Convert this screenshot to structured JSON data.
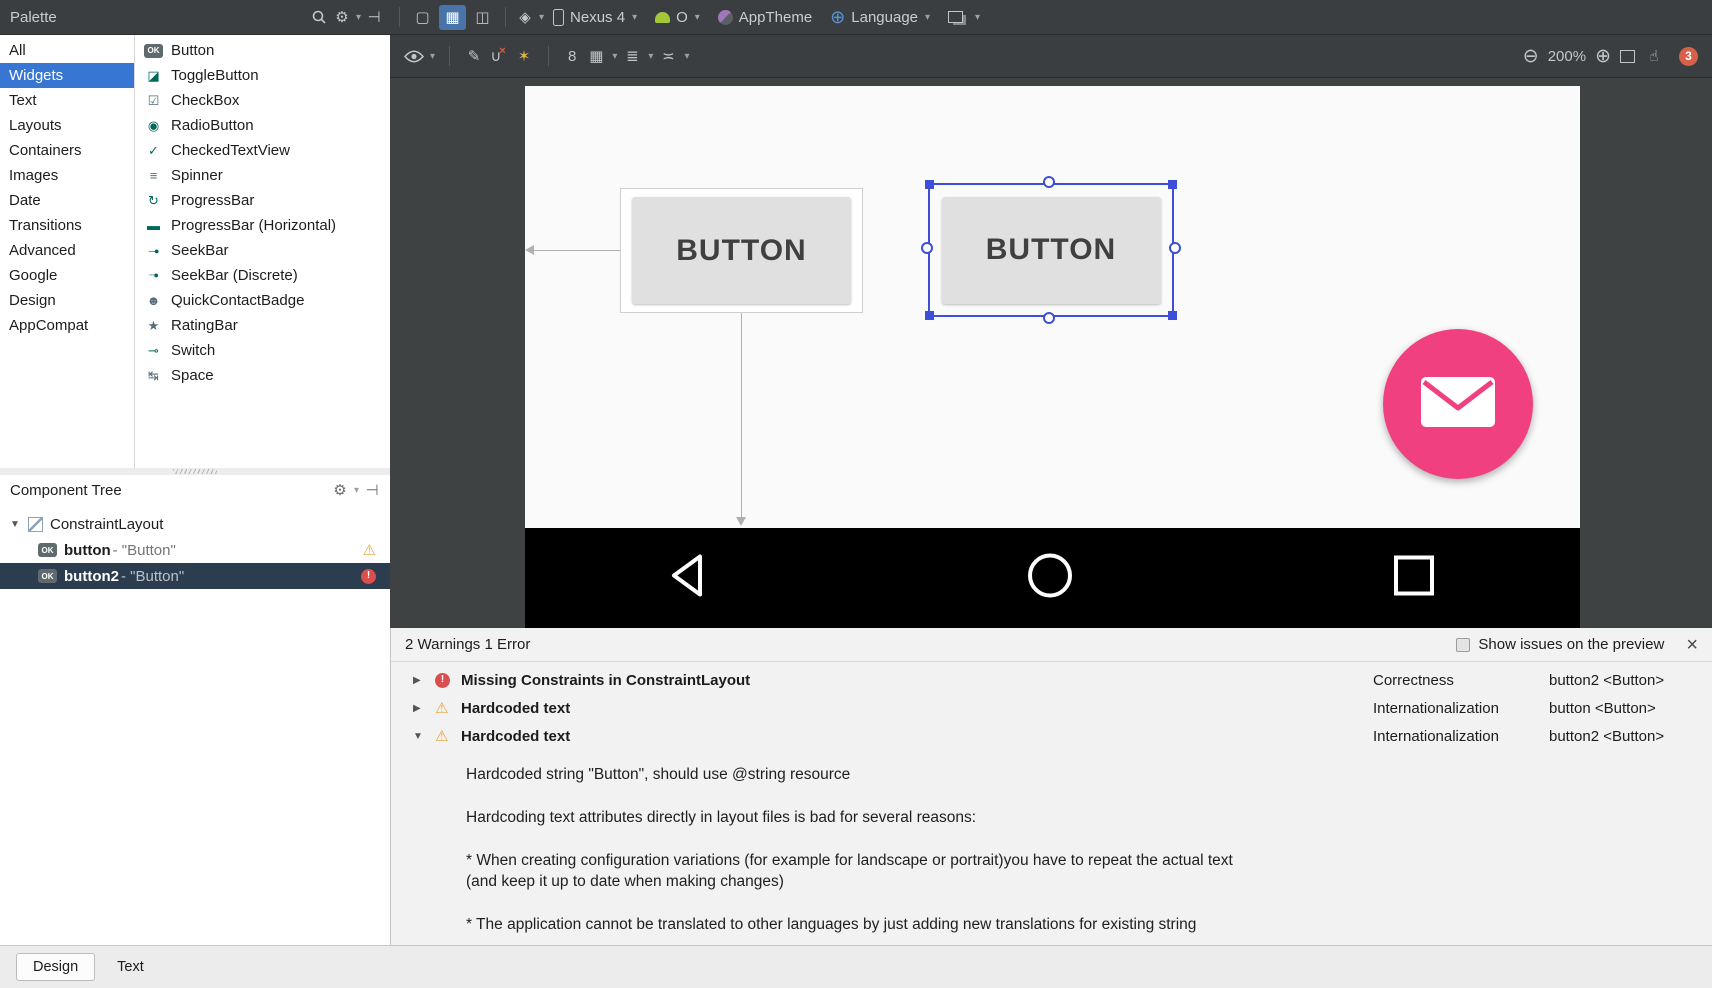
{
  "topbar": {
    "palette_title": "Palette",
    "device": "Nexus 4",
    "api_level": "O",
    "theme": "AppTheme",
    "language": "Language"
  },
  "icons": {
    "gear": "⚙",
    "caret_down": "▾",
    "hide_panel": "⊣",
    "diamond": "◈",
    "mode_design": "▢",
    "mode_split": "▦",
    "mode_blueprint": "◫",
    "globe": "⊕",
    "brush": "✎",
    "clear_u": "∪",
    "clear_x": "×",
    "infer": "✶",
    "pack": "▦",
    "align": "≣",
    "distribute": "≍",
    "zoom_out": "⊖",
    "zoom_in": "⊕",
    "pan": "☝",
    "close": "×",
    "expand": "▶",
    "collapse": "▼",
    "warning": "⚠",
    "error": "!"
  },
  "palette": {
    "categories": [
      {
        "label": "All"
      },
      {
        "label": "Widgets",
        "selected": true
      },
      {
        "label": "Text"
      },
      {
        "label": "Layouts"
      },
      {
        "label": "Containers"
      },
      {
        "label": "Images"
      },
      {
        "label": "Date"
      },
      {
        "label": "Transitions"
      },
      {
        "label": "Advanced"
      },
      {
        "label": "Google"
      },
      {
        "label": "Design"
      },
      {
        "label": "AppCompat"
      }
    ],
    "widgets": [
      {
        "label": "Button",
        "glyph": "OK"
      },
      {
        "label": "ToggleButton",
        "glyph": "◪"
      },
      {
        "label": "CheckBox",
        "glyph": "☑"
      },
      {
        "label": "RadioButton",
        "glyph": "◉"
      },
      {
        "label": "CheckedTextView",
        "glyph": "✓"
      },
      {
        "label": "Spinner",
        "glyph": "≡"
      },
      {
        "label": "ProgressBar",
        "glyph": "↻"
      },
      {
        "label": "ProgressBar (Horizontal)",
        "glyph": "▬"
      },
      {
        "label": "SeekBar",
        "glyph": "─●"
      },
      {
        "label": "SeekBar (Discrete)",
        "glyph": "┄●"
      },
      {
        "label": "QuickContactBadge",
        "glyph": "☻"
      },
      {
        "label": "RatingBar",
        "glyph": "★"
      },
      {
        "label": "Switch",
        "glyph": "⊸"
      },
      {
        "label": "Space",
        "glyph": "↹"
      }
    ]
  },
  "component_tree": {
    "title": "Component Tree",
    "nodes": [
      {
        "label": "ConstraintLayout",
        "type": "layout"
      },
      {
        "id": "button",
        "rest": " - \"Button\"",
        "badge": "warning",
        "icon_glyph": "OK"
      },
      {
        "id": "button2",
        "rest": " - \"Button\"",
        "badge": "error",
        "selected": true,
        "icon_glyph": "OK"
      }
    ]
  },
  "canvas_toolbar": {
    "margin_default": "8",
    "zoom_level": "200%",
    "issue_count": "3"
  },
  "canvas": {
    "button1_label": "BUTTON",
    "button2_label": "BUTTON"
  },
  "issues": {
    "summary": "2 Warnings 1 Error",
    "show_on_preview": "Show issues on the preview",
    "rows": [
      {
        "severity": "error",
        "title": "Missing Constraints in ConstraintLayout",
        "category": "Correctness",
        "component": "button2 <Button>",
        "expanded": false
      },
      {
        "severity": "warning",
        "title": "Hardcoded text",
        "category": "Internationalization",
        "component": "button <Button>",
        "expanded": false
      },
      {
        "severity": "warning",
        "title": "Hardcoded text",
        "category": "Internationalization",
        "component": "button2 <Button>",
        "expanded": true
      }
    ],
    "detail_lines": [
      "Hardcoded string \"Button\", should use @string resource",
      "Hardcoding text attributes directly in layout files is bad for several reasons:",
      "* When creating configuration variations (for example for landscape or portrait)you have to repeat the actual text",
      "(and keep it up to date when making changes)",
      "* The application cannot be translated to other languages by just adding new translations for existing string"
    ]
  },
  "bottom_tabs": [
    {
      "label": "Design",
      "selected": true
    },
    {
      "label": "Text",
      "selected": false
    }
  ],
  "colors": {
    "accent_blue": "#3876d3",
    "selection_blue": "#3d4fd8",
    "fab_pink": "#f1407f",
    "warning_orange": "#e8a33d",
    "error_red": "#d94f4f"
  }
}
